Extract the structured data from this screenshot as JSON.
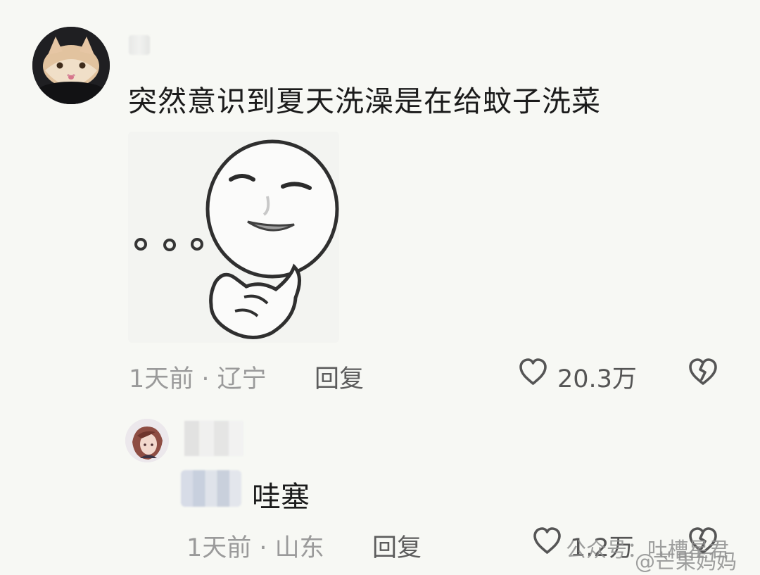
{
  "comment": {
    "text": "突然意识到夏天洗澡是在给蚊子洗菜",
    "meta": "1天前 · 辽宁",
    "reply": "回复",
    "likes": "20.3万"
  },
  "reply_comment": {
    "text": "哇塞",
    "meta": "1天前 · 山东",
    "reply": "回复",
    "likes": "1.2万"
  },
  "watermarks": {
    "center": "公众号：吐槽星君",
    "right": "@芒果妈妈"
  },
  "colors": {
    "background": "#f7f8f4",
    "text_primary": "#1b1b1b",
    "text_secondary": "#9a9a9a",
    "action": "#5c5c5c"
  },
  "icons": {
    "like": "heart-outline-icon",
    "dislike": "broken-heart-icon"
  }
}
